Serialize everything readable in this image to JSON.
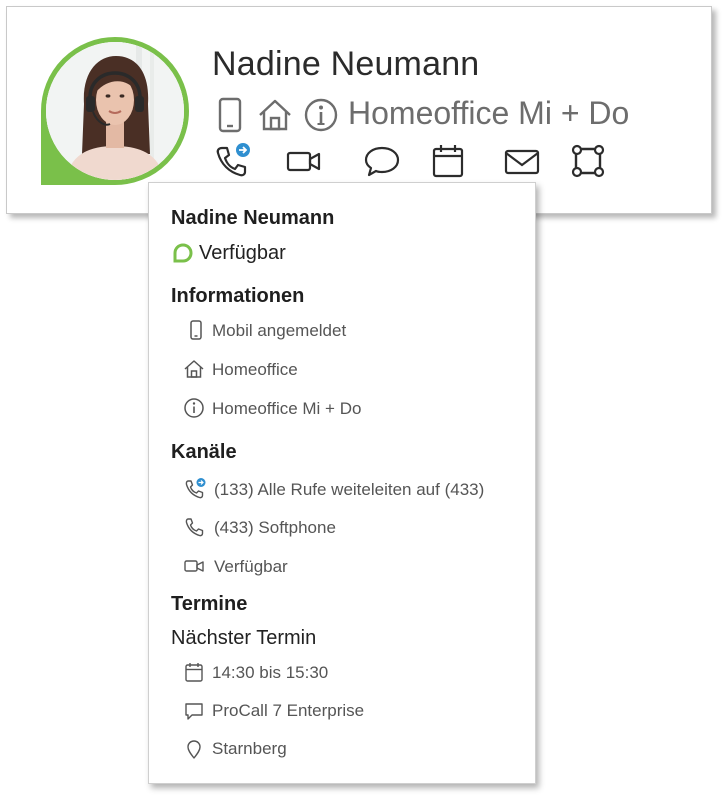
{
  "card": {
    "name": "Nadine Neumann",
    "status_text": "Homeoffice Mi + Do",
    "presence_color": "#7ac04a",
    "status_icons": [
      "mobile-icon",
      "home-icon",
      "info-icon"
    ],
    "actions": [
      "phone-forward-icon",
      "video-icon",
      "chat-icon",
      "calendar-icon",
      "mail-icon",
      "collaboration-icon"
    ]
  },
  "popup": {
    "name": "Nadine Neumann",
    "presence": "Verfügbar",
    "sections": {
      "info_title": "Informationen",
      "info_items": [
        "Mobil angemeldet",
        "Homeoffice",
        "Homeoffice Mi + Do"
      ],
      "channels_title": "Kanäle",
      "channels_items": [
        "(133) Alle Rufe weiteleiten auf (433)",
        "(433) Softphone",
        "Verfügbar"
      ],
      "appointments_title": "Termine",
      "next_label": "Nächster Termin",
      "appointment_items": [
        "14:30 bis 15:30",
        "ProCall 7 Enterprise",
        "Starnberg"
      ]
    }
  }
}
